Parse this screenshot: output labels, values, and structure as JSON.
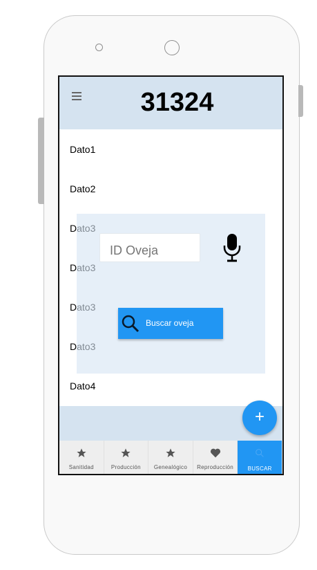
{
  "header": {
    "title": "31324"
  },
  "rows": [
    "Dato1",
    "Dato2",
    "Dato3",
    "Dato3",
    "Dato3",
    "Dato3",
    "Dato4"
  ],
  "dialog": {
    "input_placeholder": "ID Oveja",
    "search_label": "Buscar oveja"
  },
  "fab": {
    "label": "+"
  },
  "tabs": [
    {
      "label": "Sanitidad",
      "icon": "star-icon"
    },
    {
      "label": "Producción",
      "icon": "star-icon"
    },
    {
      "label": "Genealógico",
      "icon": "star-icon"
    },
    {
      "label": "Reproducción",
      "icon": "heart-icon"
    },
    {
      "label": "BUSCAR",
      "icon": "search-icon",
      "active": true
    }
  ],
  "colors": {
    "accent": "#2196f3",
    "header_bg": "#d5e3f0"
  }
}
